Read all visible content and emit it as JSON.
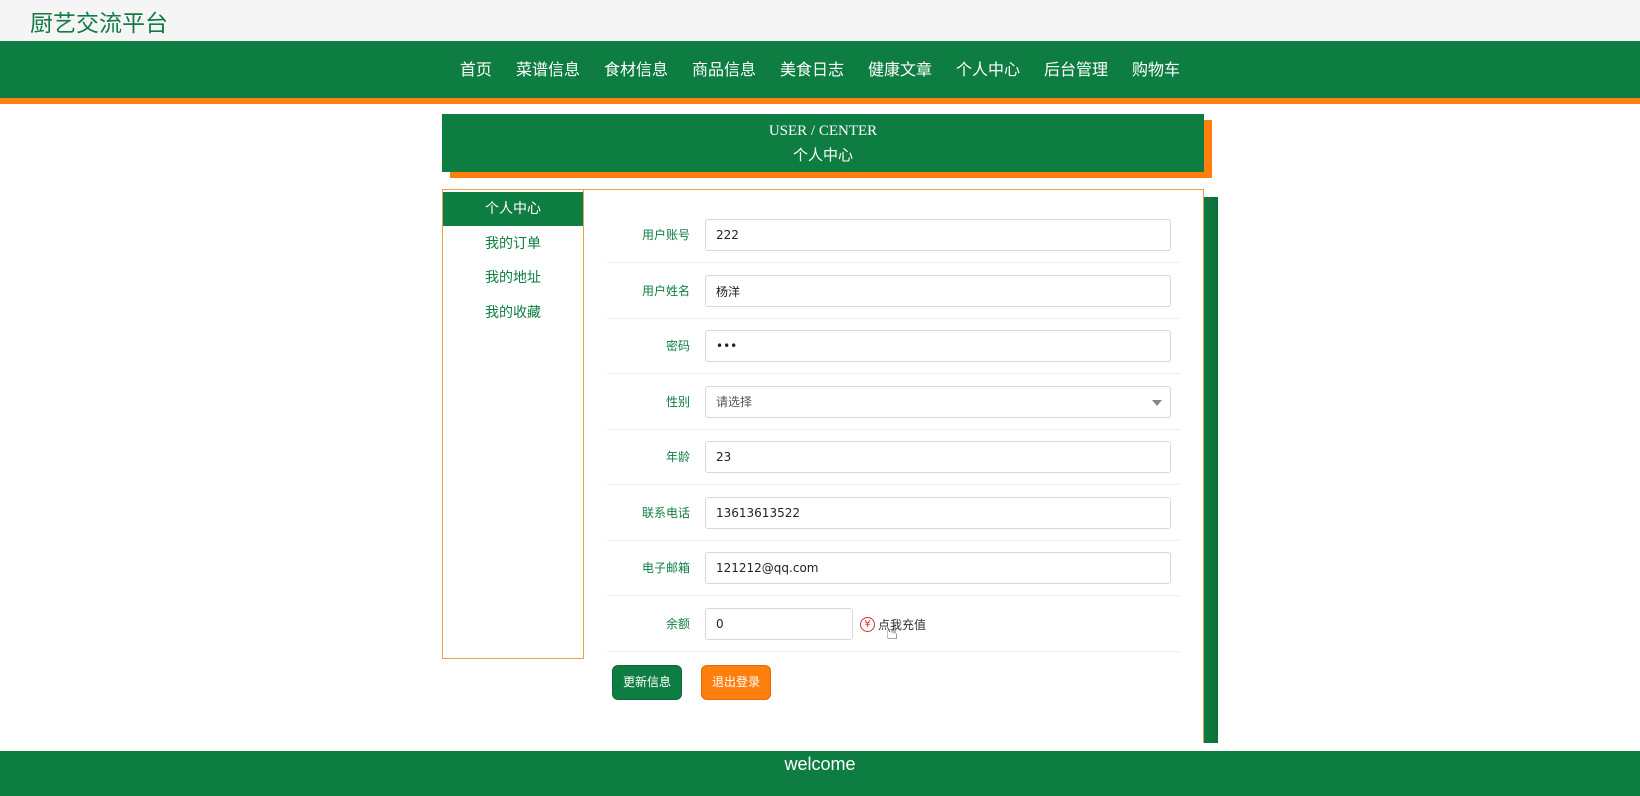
{
  "site": {
    "title": "厨艺交流平台"
  },
  "nav": {
    "items": [
      "首页",
      "菜谱信息",
      "食材信息",
      "商品信息",
      "美食日志",
      "健康文章",
      "个人中心",
      "后台管理",
      "购物车"
    ]
  },
  "center_header": {
    "en": "USER / CENTER",
    "cn": "个人中心"
  },
  "sidebar": {
    "items": [
      "个人中心",
      "我的订单",
      "我的地址",
      "我的收藏"
    ]
  },
  "form": {
    "account_label": "用户账号",
    "account_value": "222",
    "name_label": "用户姓名",
    "name_value": "杨洋",
    "password_label": "密码",
    "password_value": "•••",
    "gender_label": "性别",
    "gender_value": "请选择",
    "age_label": "年龄",
    "age_value": "23",
    "phone_label": "联系电话",
    "phone_value": "13613613522",
    "email_label": "电子邮箱",
    "email_value": "121212@qq.com",
    "balance_label": "余额",
    "balance_value": "0",
    "recharge_label": "点我充值",
    "yen_symbol": "¥"
  },
  "buttons": {
    "update": "更新信息",
    "logout": "退出登录"
  },
  "footer": {
    "text": "welcome"
  },
  "colors": {
    "primary_green": "#0e7d42",
    "accent_orange": "#ff7f0e"
  }
}
